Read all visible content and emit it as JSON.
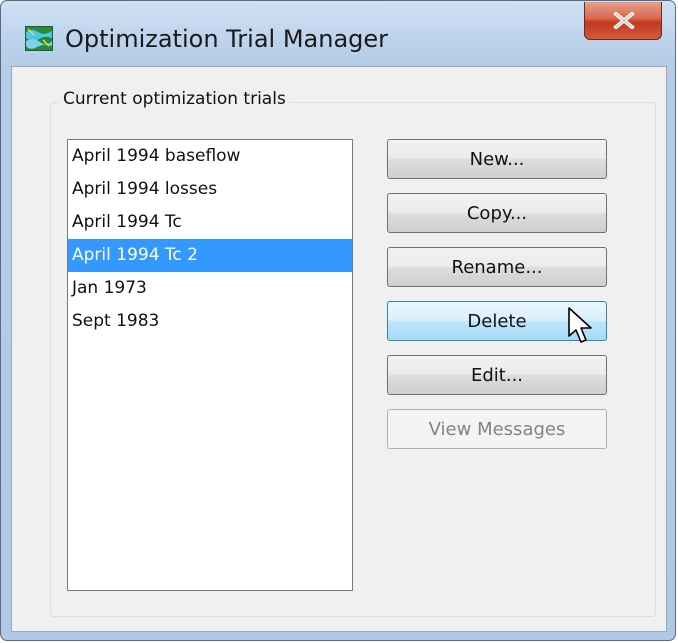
{
  "window": {
    "title": "Optimization Trial Manager",
    "close_label": "X"
  },
  "group": {
    "label": "Current optimization trials"
  },
  "trials": [
    {
      "label": "April 1994 baseflow"
    },
    {
      "label": "April 1994 losses"
    },
    {
      "label": "April 1994 Tc"
    },
    {
      "label": "April 1994 Tc 2",
      "selected": true
    },
    {
      "label": "Jan 1973"
    },
    {
      "label": "Sept 1983"
    }
  ],
  "buttons": {
    "new": "New...",
    "copy": "Copy...",
    "rename": "Rename...",
    "delete": "Delete",
    "edit": "Edit...",
    "view_messages": "View Messages"
  },
  "icons": {
    "app": "map-icon",
    "close": "close-icon",
    "cursor": "mouse-pointer-icon"
  },
  "colors": {
    "selection": "#3399ff",
    "close_button": "#c2391e",
    "hover_button": "#bee6fd"
  }
}
